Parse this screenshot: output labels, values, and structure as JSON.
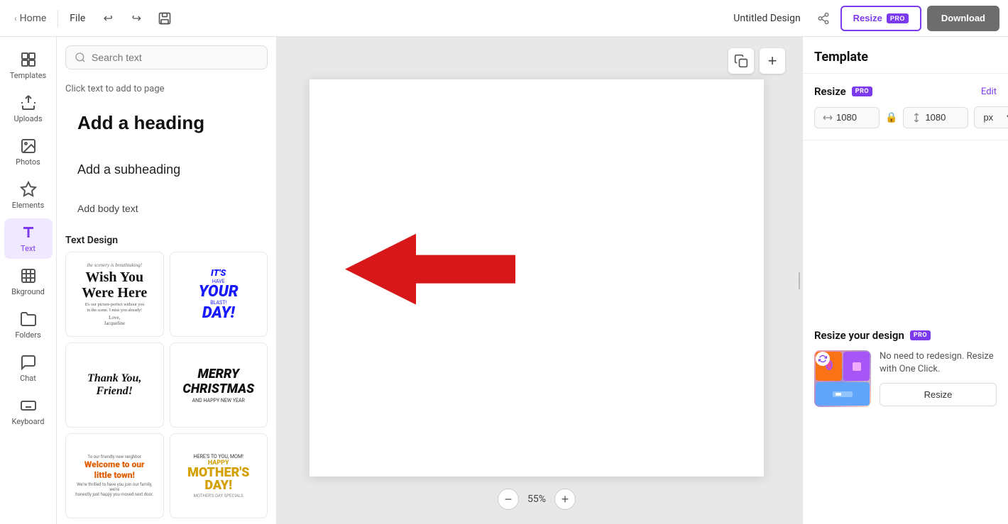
{
  "topbar": {
    "home_label": "Home",
    "file_label": "File",
    "design_title": "Untitled Design",
    "resize_label": "Resize",
    "pro_badge": "PRO",
    "download_label": "Download"
  },
  "sidebar_icons": [
    {
      "id": "templates",
      "label": "Templates",
      "active": false
    },
    {
      "id": "uploads",
      "label": "Uploads",
      "active": false
    },
    {
      "id": "photos",
      "label": "Photos",
      "active": false
    },
    {
      "id": "elements",
      "label": "Elements",
      "active": false
    },
    {
      "id": "text",
      "label": "Text",
      "active": true
    },
    {
      "id": "bkground",
      "label": "Bkground",
      "active": false
    },
    {
      "id": "folders",
      "label": "Folders",
      "active": false
    },
    {
      "id": "chat",
      "label": "Chat",
      "active": false
    },
    {
      "id": "keyboard",
      "label": "Keyboard",
      "active": false
    }
  ],
  "left_panel": {
    "search_placeholder": "Search text",
    "click_text_label": "Click text to add to page",
    "add_heading_label": "Add a heading",
    "add_subheading_label": "Add a subheading",
    "add_body_label": "Add body text",
    "text_design_label": "Text Design"
  },
  "canvas": {
    "zoom_level": "55%"
  },
  "right_panel": {
    "title": "Template",
    "resize_label": "Resize",
    "pro_badge": "PRO",
    "edit_label": "Edit",
    "width_value": "1080",
    "height_value": "1080",
    "unit_value": "px",
    "promo_title": "Resize your design",
    "promo_pro_badge": "PRO",
    "promo_desc": "No need to redesign. Resize with One Click.",
    "promo_btn_label": "Resize"
  }
}
